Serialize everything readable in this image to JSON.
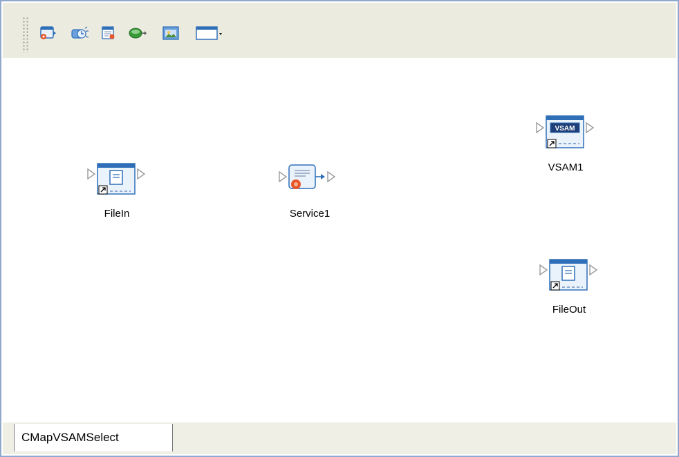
{
  "toolbar": {
    "buttons": [
      {
        "icon": "external-application-icon"
      },
      {
        "icon": "scheduler-icon"
      },
      {
        "icon": "business-process-icon"
      },
      {
        "icon": "database-icon"
      },
      {
        "icon": "image-icon"
      },
      {
        "icon": "window-dropdown-icon"
      }
    ]
  },
  "canvas": {
    "nodes": [
      {
        "id": "filein",
        "label": "FileIn",
        "icon": "file-connector-icon"
      },
      {
        "id": "service1",
        "label": "Service1",
        "icon": "service-icon"
      },
      {
        "id": "vsam1",
        "label": "VSAM1",
        "icon": "vsam-connector-icon",
        "badge": "VSAM"
      },
      {
        "id": "fileout",
        "label": "FileOut",
        "icon": "file-connector-icon"
      }
    ]
  },
  "tabs": [
    {
      "label": "CMapVSAMSelect",
      "active": true
    }
  ],
  "colors": {
    "frame_border": "#8fa8cc",
    "toolbar_bg": "#ecebe0",
    "icon_blue": "#2f6fb8",
    "port_gray": "#9a9a9a"
  }
}
